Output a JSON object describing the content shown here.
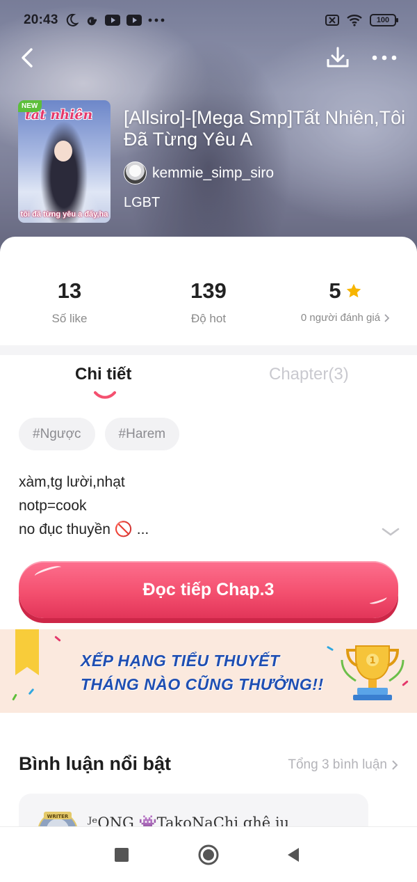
{
  "status_bar": {
    "time": "20:43",
    "battery": "100",
    "icons": [
      "moon-icon",
      "google-icon",
      "youtube-icon",
      "youtube-icon",
      "more-dots-icon",
      "sim-icon",
      "wifi-icon",
      "battery-icon"
    ]
  },
  "book": {
    "cover_title": "tất nhiên",
    "cover_subtitle": "tôi đã từng yêu a đấy,ha",
    "new_badge": "NEW",
    "title": "[Allsiro]-[Mega Smp]Tất Nhiên,Tôi Đã Từng Yêu A",
    "author": "kemmie_simp_siro",
    "category": "LGBT"
  },
  "stats": {
    "likes": {
      "value": "13",
      "label": "Số like"
    },
    "hot": {
      "value": "139",
      "label": "Độ hot"
    },
    "rating": {
      "value": "5",
      "label": "0 người đánh giá"
    }
  },
  "tabs": {
    "detail": "Chi tiết",
    "chapter": "Chapter(3)"
  },
  "tags": [
    "#Ngược",
    "#Harem"
  ],
  "description": [
    "xàm,tg lười,nhạt",
    "notp=cook",
    "no đục thuyền 🚫 ..."
  ],
  "read_button": "Đọc tiếp Chap.3",
  "banner": {
    "line1": "XẾP HẠNG TIỂU THUYẾT",
    "line2": "THÁNG NÀO CŨNG THƯỞNG!!",
    "trophy_label": "1"
  },
  "comments": {
    "title": "Bình luận nổi bật",
    "total": "Tổng 3 bình luận",
    "first_user": "ᴶᵉONG 👾TakoNaChi ghê iu",
    "avatar_badge": "WRITER"
  },
  "colors": {
    "accent": "#f4506f",
    "star": "#f7b500",
    "banner_text": "#1f4fb3",
    "banner_bg": "#fbe9de"
  }
}
